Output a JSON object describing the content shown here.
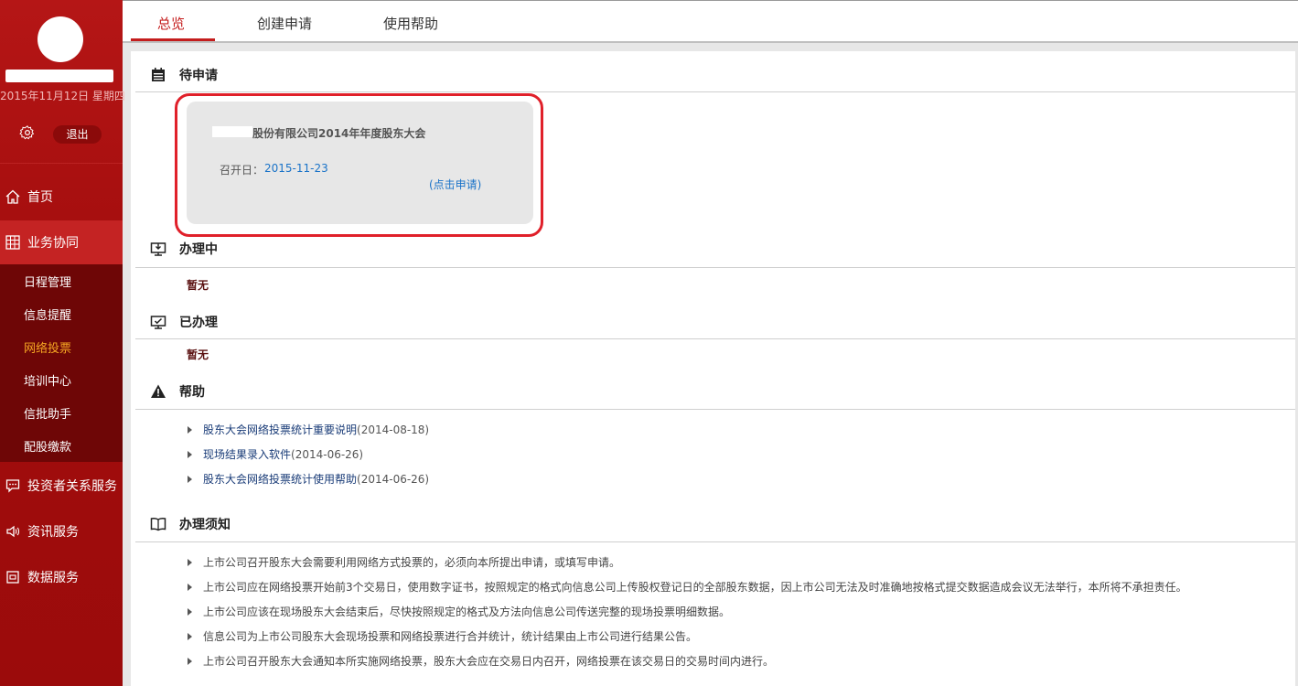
{
  "sidebar": {
    "date": "2015年11月12日 星期四",
    "logout_label": "退出",
    "nav": [
      {
        "label": "首页",
        "icon": "home-icon"
      },
      {
        "label": "业务协同",
        "icon": "grid-icon"
      },
      {
        "label": "投资者关系服务",
        "icon": "chat-icon"
      },
      {
        "label": "资讯服务",
        "icon": "speaker-icon"
      },
      {
        "label": "数据服务",
        "icon": "database-icon"
      }
    ],
    "submenu": [
      "日程管理",
      "信息提醒",
      "网络投票",
      "培训中心",
      "信批助手",
      "配股缴款"
    ],
    "current_submenu": "网络投票"
  },
  "tabs": [
    "总览",
    "创建申请",
    "使用帮助"
  ],
  "sections": {
    "pending": {
      "title": "待申请",
      "card": {
        "title": "股份有限公司2014年年度股东大会",
        "date_label": "召开日：",
        "date": "2015-11-23",
        "link": "(点击申请)"
      }
    },
    "processing": {
      "title": "办理中",
      "empty": "暂无"
    },
    "done": {
      "title": "已办理",
      "empty": "暂无"
    },
    "help": {
      "title": "帮助",
      "items": [
        {
          "text": "股东大会网络投票统计重要说明",
          "date": "(2014-08-18)"
        },
        {
          "text": "现场结果录入软件",
          "date": "(2014-06-26)"
        },
        {
          "text": "股东大会网络投票统计使用帮助",
          "date": "(2014-06-26)"
        }
      ]
    },
    "notice": {
      "title": "办理须知",
      "items": [
        "上市公司召开股东大会需要利用网络方式投票的，必须向本所提出申请，或填写申请。",
        "上市公司应在网络投票开始前3个交易日，使用数字证书，按照规定的格式向信息公司上传股权登记日的全部股东数据，因上市公司无法及时准确地按格式提交数据造成会议无法举行，本所将不承担责任。",
        "上市公司应该在现场股东大会结束后，尽快按照规定的格式及方法向信息公司传送完整的现场投票明细数据。",
        "信息公司为上市公司股东大会现场投票和网络投票进行合并统计，统计结果由上市公司进行结果公告。",
        "上市公司召开股东大会通知本所实施网络投票，股东大会应在交易日内召开，网络投票在该交易日的交易时间内进行。"
      ]
    }
  }
}
